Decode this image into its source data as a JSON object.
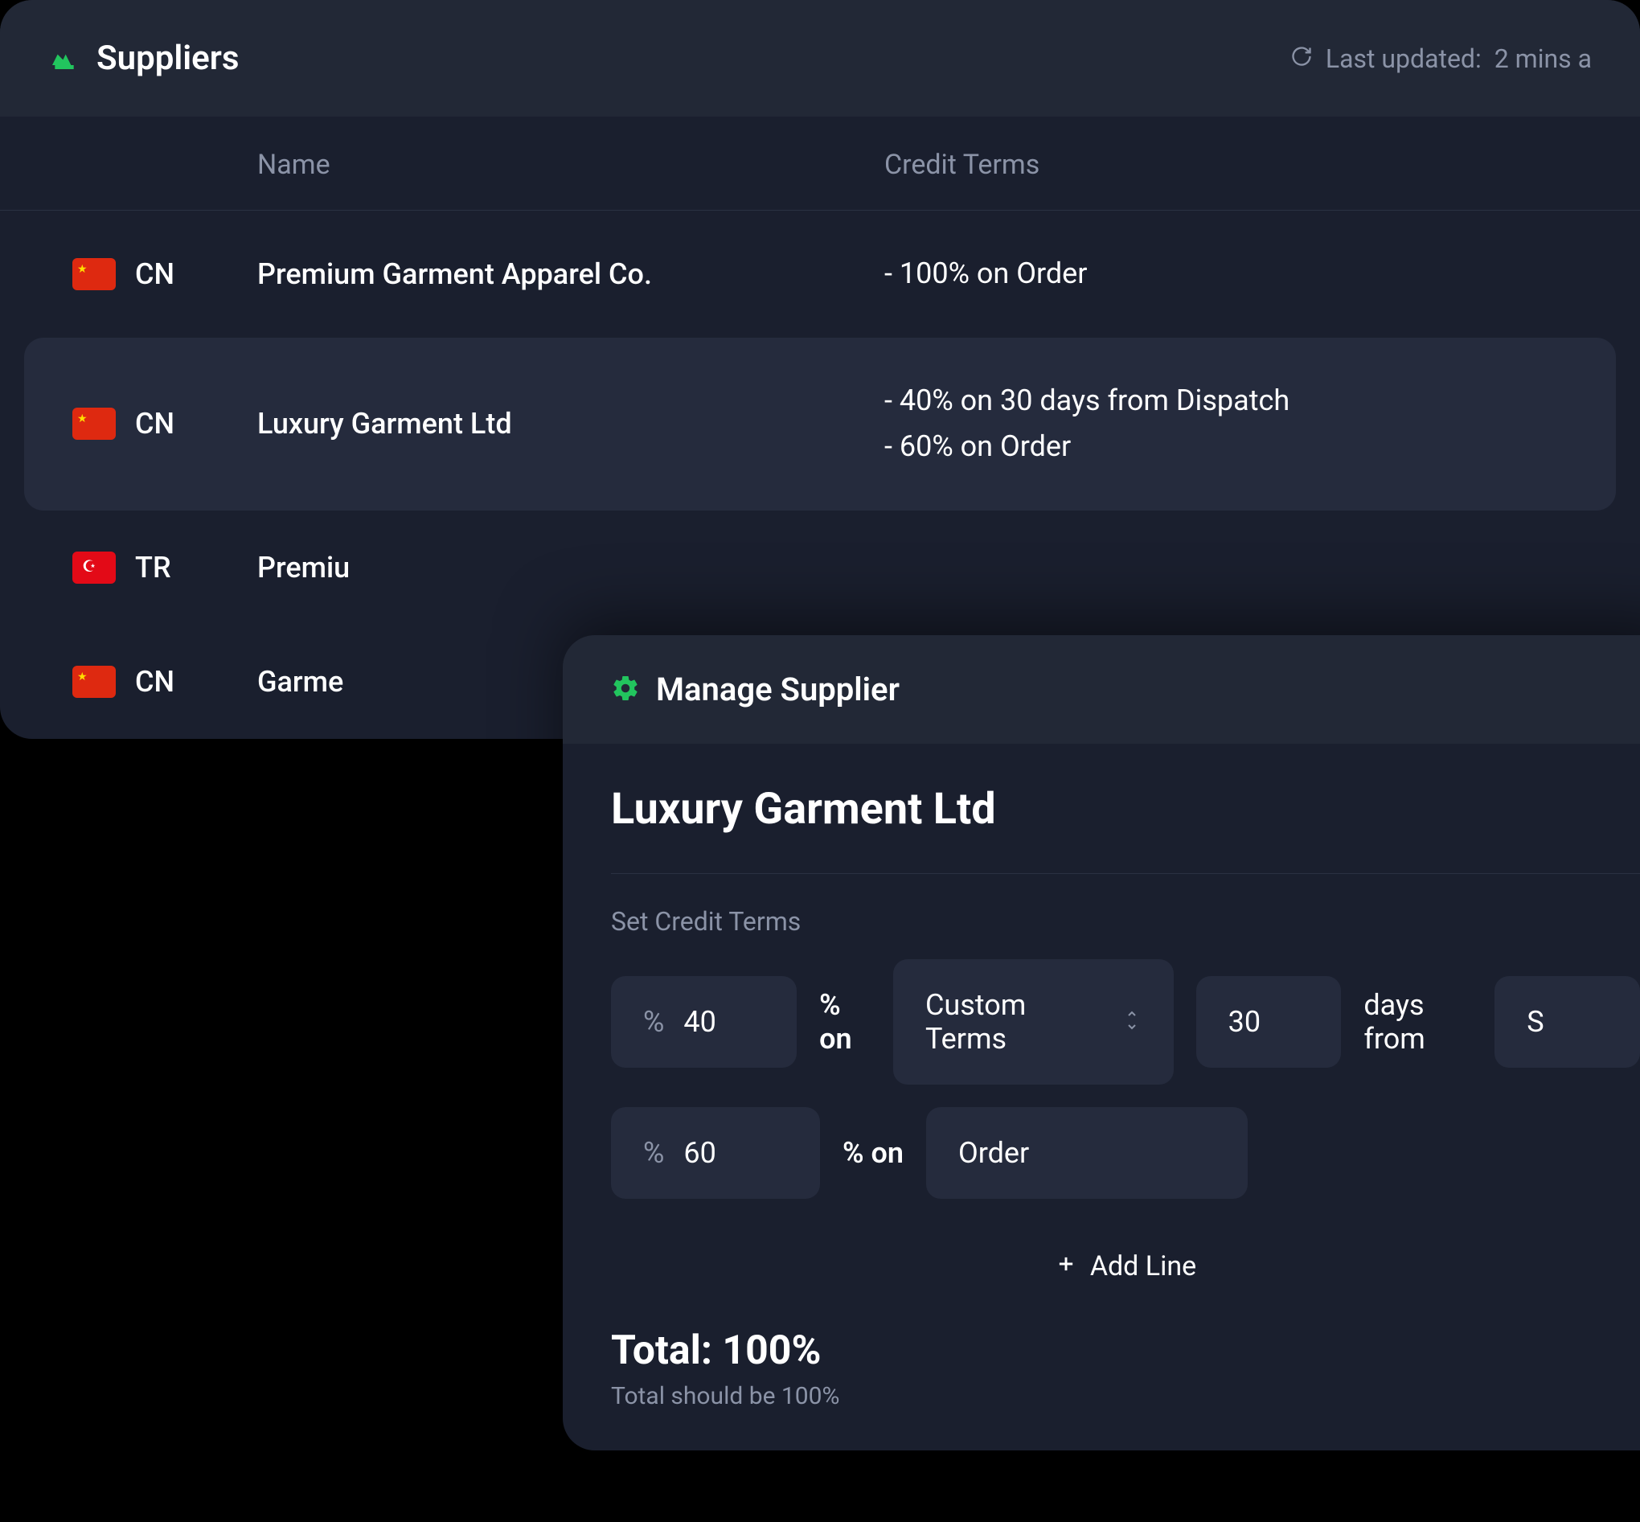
{
  "suppliers_card": {
    "title": "Suppliers",
    "last_updated_prefix": "Last updated:",
    "last_updated_value": "2 mins a",
    "columns": {
      "name": "Name",
      "credit_terms": "Credit Terms"
    },
    "rows": [
      {
        "country_code": "CN",
        "flag": "cn",
        "name": "Premium Garment Apparel Co.",
        "terms": "- 100% on Order",
        "selected": false
      },
      {
        "country_code": "CN",
        "flag": "cn",
        "name": "Luxury Garment Ltd",
        "terms": "- 40% on 30 days from Dispatch\n- 60% on Order",
        "selected": true
      },
      {
        "country_code": "TR",
        "flag": "tr",
        "name": "Premiu",
        "terms": "",
        "selected": false
      },
      {
        "country_code": "CN",
        "flag": "cn",
        "name": "Garme",
        "terms": "",
        "selected": false
      }
    ]
  },
  "manage_card": {
    "title": "Manage Supplier",
    "supplier_name": "Luxury Garment Ltd",
    "section_label": "Set Credit Terms",
    "percent_on_label": "% on",
    "days_from_label": "days from",
    "term_lines": [
      {
        "percent": "40",
        "type": "Custom Terms",
        "days": "30",
        "from": "S",
        "show_days": true
      },
      {
        "percent": "60",
        "type": "Order",
        "show_days": false
      }
    ],
    "add_line_label": "Add Line",
    "total_label": "Total: 100%",
    "total_hint": "Total should be 100%"
  },
  "colors": {
    "accent": "#22c55e",
    "bg_card": "#1a1f2e",
    "bg_header": "#222836",
    "bg_input": "#252b3d",
    "text_muted": "#8b93a7"
  }
}
